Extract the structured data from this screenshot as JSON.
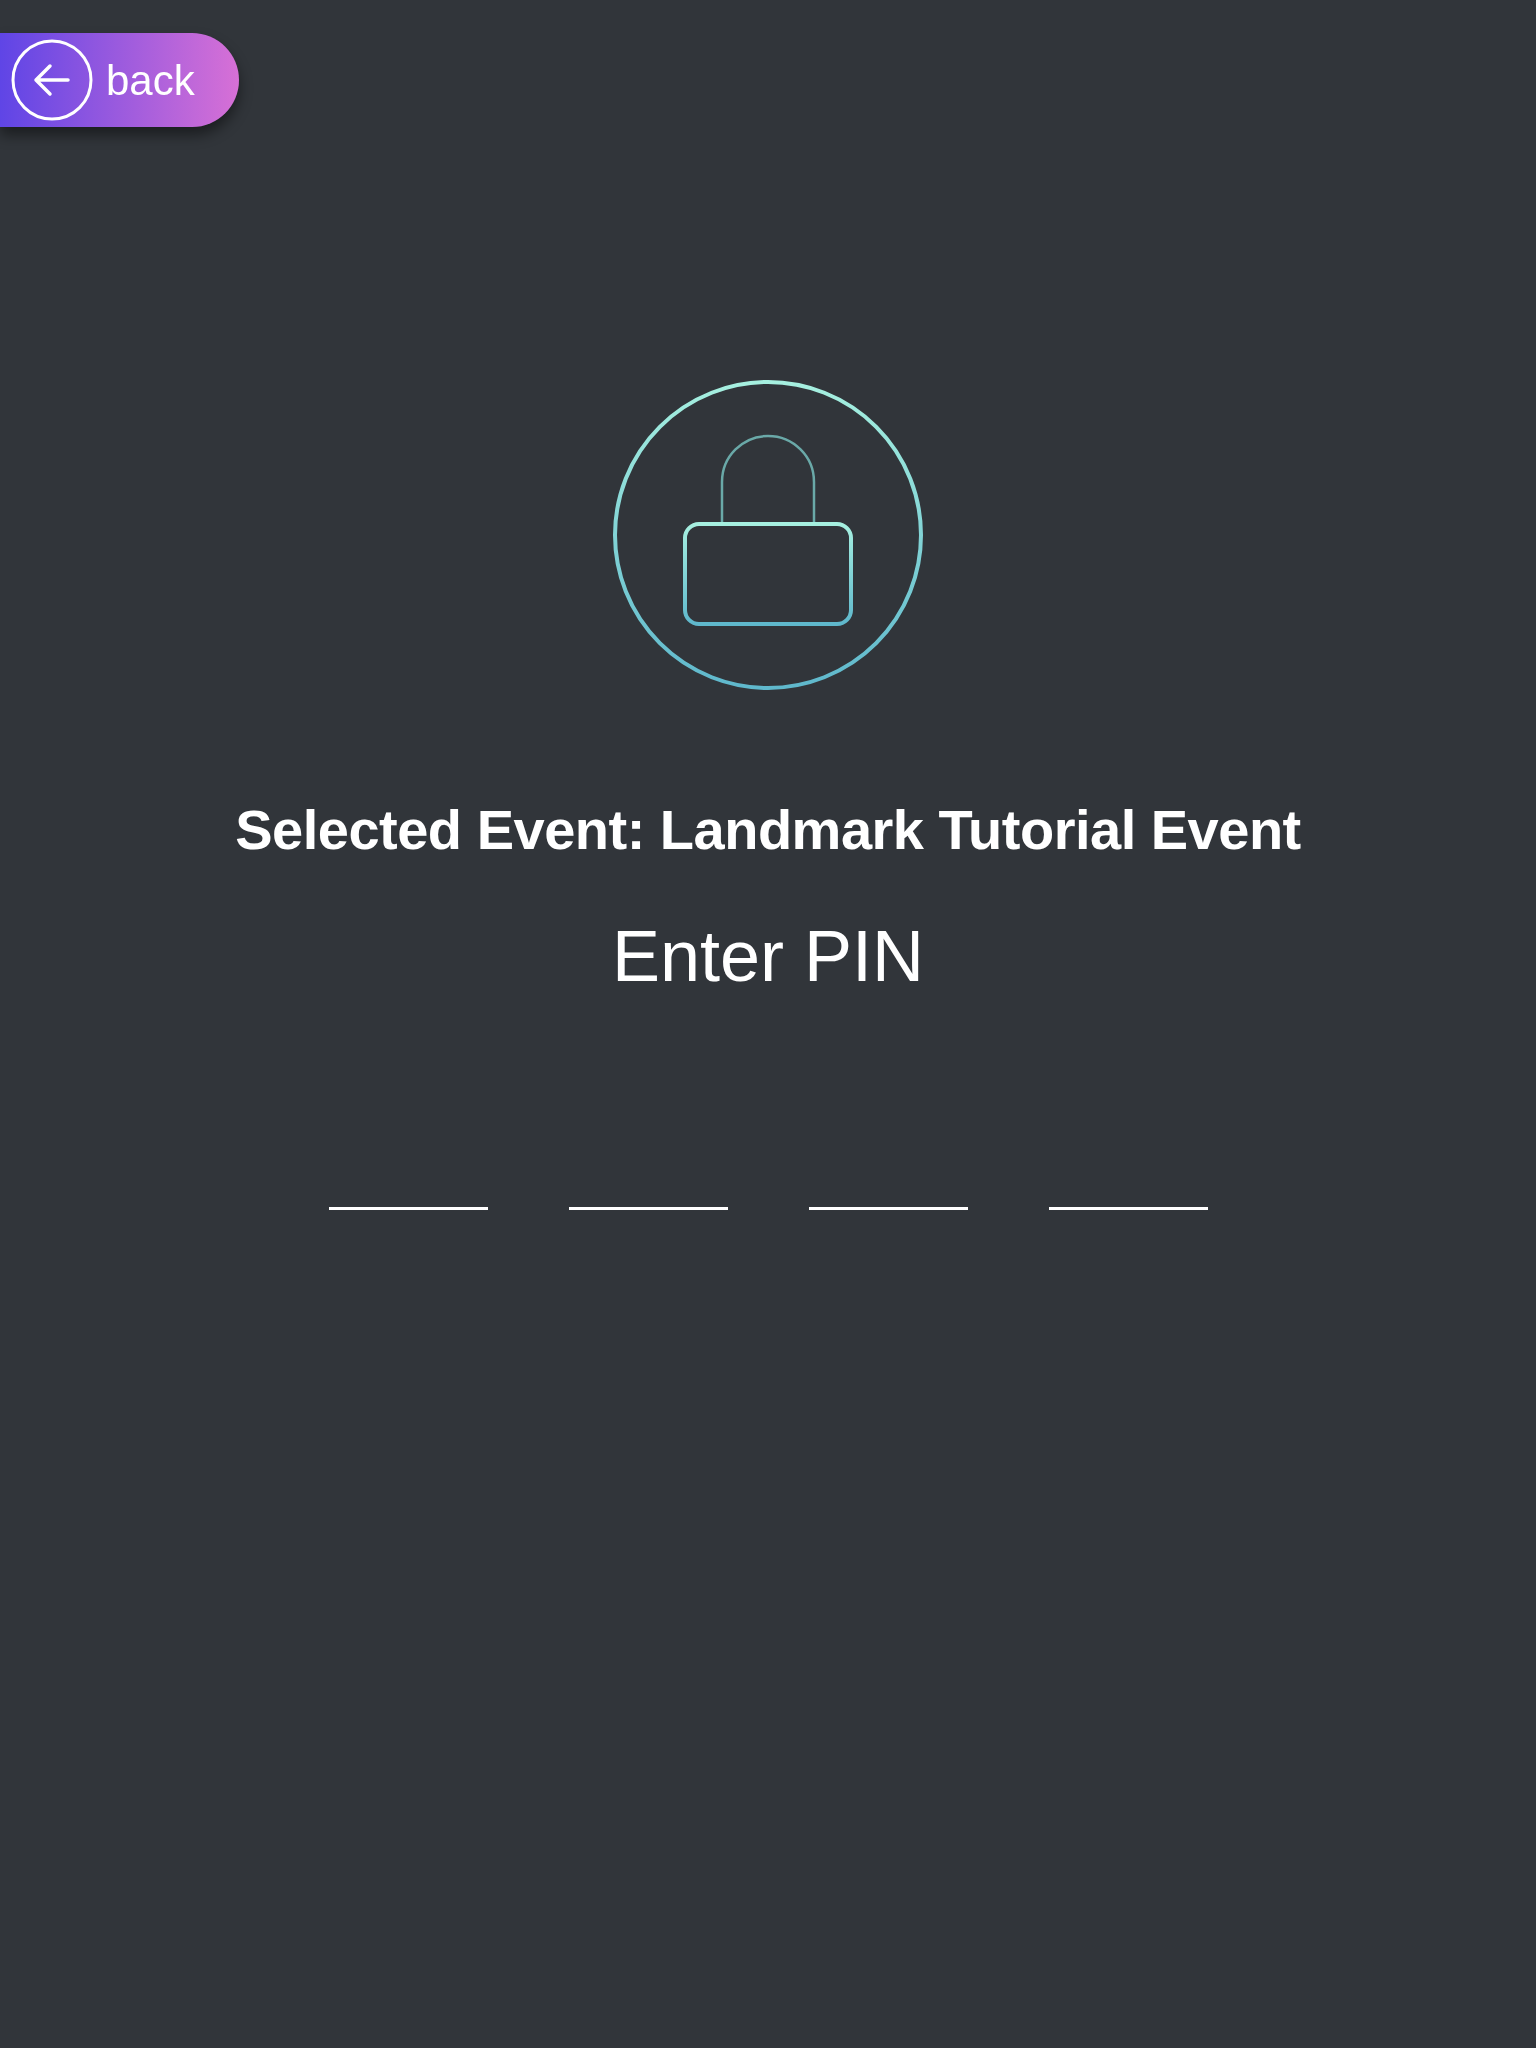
{
  "back_button": {
    "label": "back"
  },
  "title": "Selected Event: Landmark Tutorial Event",
  "prompt": "Enter PIN",
  "pin_slots": [
    {
      "filled": false
    },
    {
      "filled": false
    },
    {
      "filled": false
    },
    {
      "filled": false
    }
  ]
}
